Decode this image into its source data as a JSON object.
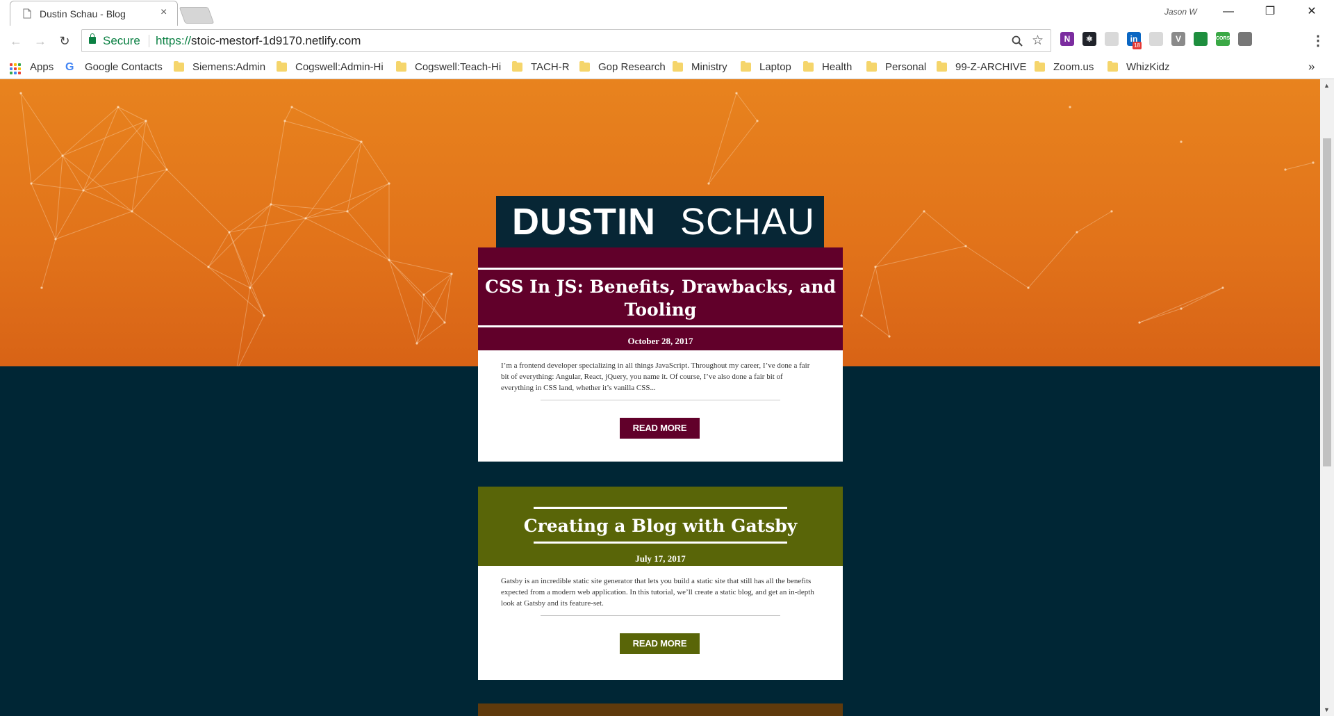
{
  "browser": {
    "tab_title": "Dustin Schau - Blog",
    "tab_close": "×",
    "profile_name": "Jason W",
    "window_controls": [
      "—",
      "❐",
      "✕"
    ],
    "nav": {
      "back": "←",
      "forward": "→",
      "reload": "↻"
    },
    "omnibox": {
      "secure_label": "Secure",
      "url_scheme": "https://",
      "url_rest": "stoic-mestorf-1d9170.netlify.com",
      "zoom_icon": "magnifier-icon",
      "star_icon": "star-icon"
    },
    "menu_icon": "⋮",
    "extensions": [
      {
        "name": "onenote-icon",
        "color": "#7b2c9f",
        "text": "N"
      },
      {
        "name": "react-devtools-icon",
        "color": "#20232a",
        "text": "⚛"
      },
      {
        "name": "circle-ext-icon",
        "color": "#d9d9d9",
        "text": ""
      },
      {
        "name": "linkedin-icon",
        "color": "#0a66c2",
        "text": "in",
        "badge": "18"
      },
      {
        "name": "swirl-ext-icon",
        "color": "#d9d9d9",
        "text": ""
      },
      {
        "name": "vue-icon",
        "color": "#8a8a8a",
        "text": "V"
      },
      {
        "name": "search-ext-icon",
        "color": "#1e8e3e",
        "text": ""
      },
      {
        "name": "cors-icon",
        "color": "#3aa845",
        "text": "CORS"
      },
      {
        "name": "puzzle-ext-icon",
        "color": "#777777",
        "text": ""
      }
    ]
  },
  "bookmarks": {
    "apps": "Apps",
    "items": [
      "Google Contacts",
      "Siemens:Admin",
      "Cogswell:Admin-Hi",
      "Cogswell:Teach-Hi",
      "TACH-R",
      "Gop Research",
      "Ministry",
      "Laptop",
      "Health",
      "Personal",
      "99-Z-ARCHIVE",
      "Zoom.us",
      "WhizKidz"
    ],
    "overflow": "»"
  },
  "site": {
    "logo_first": "DUSTIN",
    "logo_last": "SCHAU",
    "hero_color": "#e8831e",
    "page_bg": "#002635",
    "posts": [
      {
        "title_line1": "CSS In JS: Benefits, Drawbacks, and",
        "title_line2": "Tooling",
        "date": "October 28, 2017",
        "excerpt": "I’m a frontend developer specializing in all things JavaScript. Throughout my career, I’ve done a fair bit of everything: Angular, React, jQuery, you name it. Of course, I’ve also done a fair bit of everything in CSS land, whether it’s vanilla CSS...",
        "button": "READ MORE",
        "color": "#61002a"
      },
      {
        "title_line1": "Creating a Blog with Gatsby",
        "date": "July 17, 2017",
        "excerpt": "Gatsby is an incredible static site generator that lets you build a static site that still has all the benefits expected from a modern web application. In this tutorial, we’ll create a static blog, and get an in-depth look at Gatsby and its feature-set.",
        "button": "READ MORE",
        "color": "#596508"
      }
    ],
    "next_post_color": "#5f3a0c"
  }
}
